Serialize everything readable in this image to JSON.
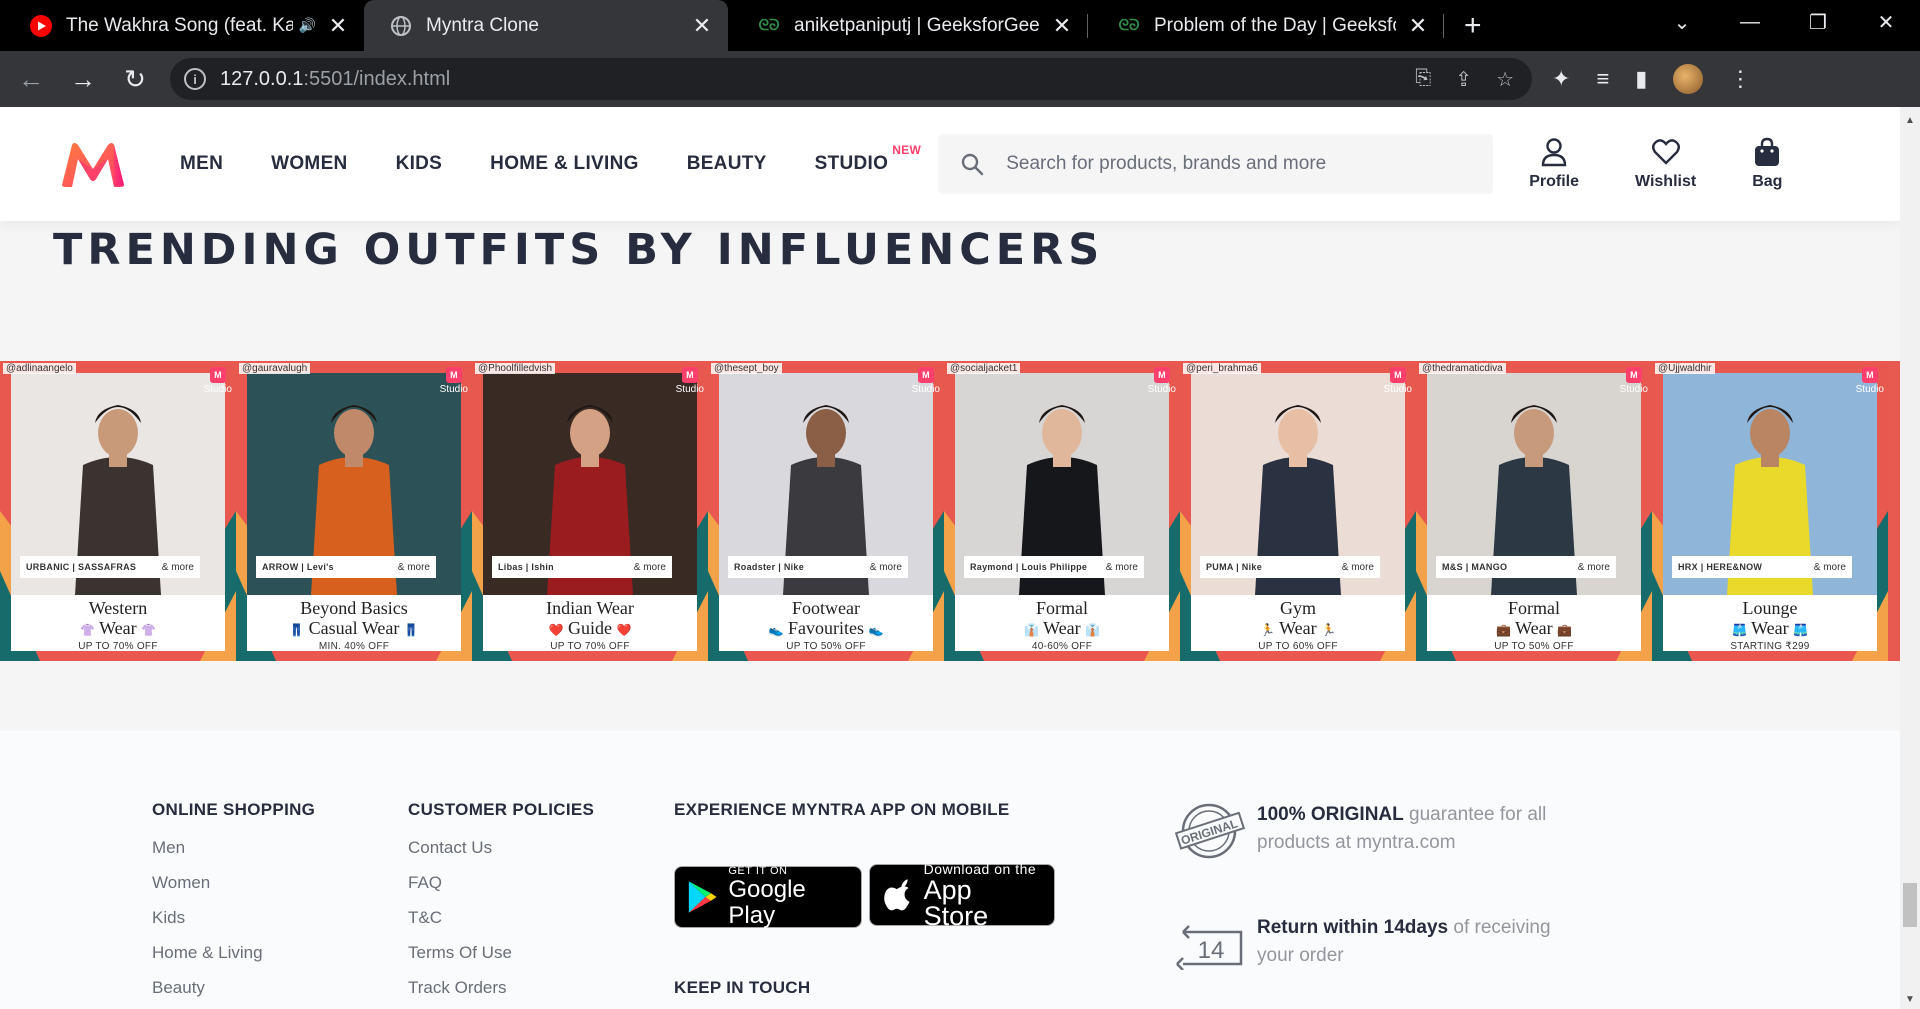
{
  "browser": {
    "tabs": [
      {
        "title": "The Wakhra Song (feat. Kang",
        "icon": "youtube-icon",
        "audio": "🔊"
      },
      {
        "title": "Myntra Clone",
        "icon": "globe-icon",
        "active": true
      },
      {
        "title": "aniketpaniputj | GeeksforGeeks P",
        "icon": "gfg-icon"
      },
      {
        "title": "Problem of the Day | GeeksforGe",
        "icon": "gfg-icon"
      }
    ],
    "url_host": "127.0.0.1",
    "url_path": ":5501/index.html"
  },
  "header": {
    "nav": [
      "MEN",
      "WOMEN",
      "KIDS",
      "HOME & LIVING",
      "BEAUTY",
      "STUDIO"
    ],
    "studio_badge": "NEW",
    "search_placeholder": "Search for products, brands and more",
    "actions": [
      "Profile",
      "Wishlist",
      "Bag"
    ]
  },
  "trending": {
    "title": "TRENDING OUTFITS BY INFLUENCERS",
    "studio_label": "Studio",
    "cards": [
      {
        "handle": "@adlinaangelo",
        "brands": "URBANIC | SASSAFRAS",
        "more": "& more",
        "line1": "Western",
        "line2": "Wear",
        "emoji": "👚",
        "offer": "UP TO 70% OFF",
        "skin": "#c89a7a",
        "cloth": "#3a3330",
        "bg": "#e9e6e3"
      },
      {
        "handle": "@gauravalugh",
        "brands": "ARROW | Levi's",
        "more": "& more",
        "line1": "Beyond Basics",
        "line2": "Casual Wear",
        "emoji": "👖",
        "offer": "MIN. 40% OFF",
        "skin": "#c08a6a",
        "cloth": "#d7601f",
        "bg": "#2c5257"
      },
      {
        "handle": "@Phoolfilledvish",
        "brands": "Libas | Ishin",
        "more": "& more",
        "line1": "Indian Wear",
        "line2": "Guide",
        "emoji": "❤️",
        "offer": "UP TO 70% OFF",
        "skin": "#d4a184",
        "cloth": "#9b1c1f",
        "bg": "#3a2a24"
      },
      {
        "handle": "@thesept_boy",
        "brands": "Roadster | Nike",
        "more": "& more",
        "line1": "Footwear",
        "line2": "Favourites",
        "emoji": "👟",
        "offer": "UP TO 50% OFF",
        "skin": "#8a5f45",
        "cloth": "#3b3b3f",
        "bg": "#d9d9dd"
      },
      {
        "handle": "@socialjacket1",
        "brands": "Raymond | Louis Philippe",
        "more": "& more",
        "line1": "Formal",
        "line2": "Wear",
        "emoji": "👔",
        "offer": "40-60% OFF",
        "skin": "#e0b79a",
        "cloth": "#16171b",
        "bg": "#d8d6d4"
      },
      {
        "handle": "@peri_brahma6",
        "brands": "PUMA | Nike",
        "more": "& more",
        "line1": "Gym",
        "line2": "Wear",
        "emoji": "🏃",
        "offer": "UP TO 60% OFF",
        "skin": "#e6bfa5",
        "cloth": "#2a3140",
        "bg": "#ecdcd6"
      },
      {
        "handle": "@thedramaticdiva",
        "brands": "M&S | MANGO",
        "more": "& more",
        "line1": "Formal",
        "line2": "Wear",
        "emoji": "💼",
        "offer": "UP TO 50% OFF",
        "skin": "#c79a7c",
        "cloth": "#2c3945",
        "bg": "#d8d4cf"
      },
      {
        "handle": "@Ujjwaldhir",
        "brands": "HRX | HERE&NOW",
        "more": "& more",
        "line1": "Lounge",
        "line2": "Wear",
        "emoji": "🩳",
        "offer": "STARTING ₹299",
        "skin": "#b98563",
        "cloth": "#e8d92a",
        "bg": "#8fb6d8"
      }
    ]
  },
  "footer": {
    "online_shopping": {
      "title": "ONLINE SHOPPING",
      "links": [
        "Men",
        "Women",
        "Kids",
        "Home & Living",
        "Beauty"
      ]
    },
    "customer_policies": {
      "title": "CUSTOMER POLICIES",
      "links": [
        "Contact Us",
        "FAQ",
        "T&C",
        "Terms Of Use",
        "Track Orders"
      ]
    },
    "app": {
      "title": "EXPERIENCE MYNTRA APP ON MOBILE",
      "google_small": "GET IT ON",
      "google_big": "Google Play",
      "apple_small": "Download on the",
      "apple_big": "App Store",
      "keep_in_touch": "KEEP IN TOUCH"
    },
    "original": {
      "bold": "100% ORIGINAL",
      "rest": " guarantee for all products at myntra.com",
      "stamp": "ORIGINAL"
    },
    "return": {
      "bold": "Return within 14days",
      "rest": " of receiving your order",
      "days": "14"
    }
  },
  "colors": {
    "accent": "#ff3f6c",
    "text": "#282c3f",
    "muted": "#696e79"
  }
}
